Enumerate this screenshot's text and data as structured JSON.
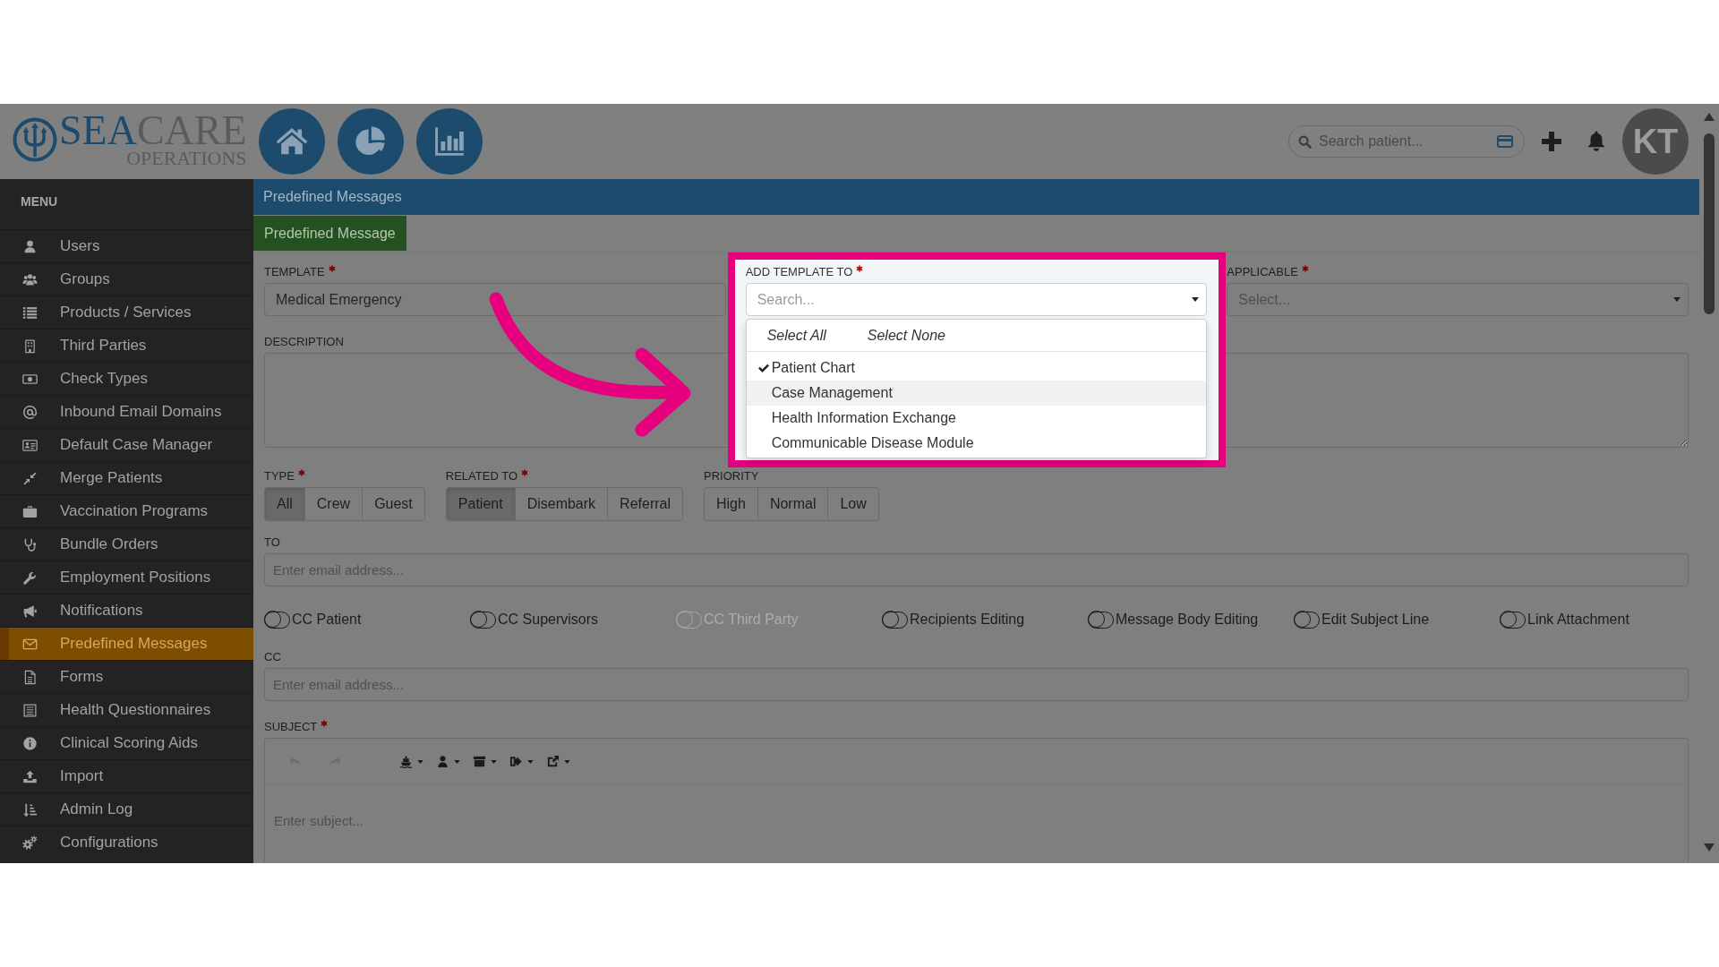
{
  "header": {
    "logo": {
      "wordmark": [
        {
          "text": "SEA",
          "color": "#1c4b6e"
        },
        {
          "text": "CARE",
          "color": "#5b5b5b"
        }
      ],
      "tagline": "OPERATIONS"
    },
    "search": {
      "placeholder": "Search patient..."
    },
    "avatar": {
      "initials": "KT"
    }
  },
  "sidebar": {
    "title": "MENU",
    "items": [
      {
        "label": "Users",
        "selected": false
      },
      {
        "label": "Groups",
        "selected": false
      },
      {
        "label": "Products / Services",
        "selected": false
      },
      {
        "label": "Third Parties",
        "selected": false
      },
      {
        "label": "Check Types",
        "selected": false
      },
      {
        "label": "Inbound Email Domains",
        "selected": false
      },
      {
        "label": "Default Case Manager",
        "selected": false
      },
      {
        "label": "Merge Patients",
        "selected": false
      },
      {
        "label": "Vaccination Programs",
        "selected": false
      },
      {
        "label": "Bundle Orders",
        "selected": false
      },
      {
        "label": "Employment Positions",
        "selected": false
      },
      {
        "label": "Notifications",
        "selected": false
      },
      {
        "label": "Predefined Messages",
        "selected": true
      },
      {
        "label": "Forms",
        "selected": false
      },
      {
        "label": "Health Questionnaires",
        "selected": false
      },
      {
        "label": "Clinical Scoring Aids",
        "selected": false
      },
      {
        "label": "Import",
        "selected": false
      },
      {
        "label": "Admin Log",
        "selected": false
      },
      {
        "label": "Configurations",
        "selected": false
      }
    ]
  },
  "page": {
    "title": "Predefined Messages",
    "tabs": [
      {
        "label": "Predefined Message",
        "selected": true
      }
    ]
  },
  "form": {
    "template": {
      "label": "TEMPLATE",
      "required": true,
      "value": "Medical Emergency"
    },
    "add_template_to": {
      "label": "ADD TEMPLATE TO",
      "required": true,
      "placeholder": "Search...",
      "expanded": true,
      "highlighted": true,
      "actions": [
        "Select All",
        "Select None"
      ],
      "options": [
        {
          "label": "Patient Chart",
          "checked": true,
          "highlighted": false
        },
        {
          "label": "Case Management",
          "checked": false,
          "highlighted": true
        },
        {
          "label": "Health Information Exchange",
          "checked": false,
          "highlighted": false
        },
        {
          "label": "Communicable Disease Module",
          "checked": false,
          "highlighted": false
        }
      ]
    },
    "applicable": {
      "label": "APPLICABLE",
      "required": true,
      "placeholder": "Select..."
    },
    "description": {
      "label": "DESCRIPTION"
    },
    "type": {
      "label": "TYPE",
      "required": true,
      "options": [
        {
          "label": "All",
          "selected": true
        },
        {
          "label": "Crew",
          "selected": false
        },
        {
          "label": "Guest",
          "selected": false
        }
      ]
    },
    "related_to": {
      "label": "RELATED TO",
      "required": true,
      "options": [
        {
          "label": "Patient",
          "selected": true
        },
        {
          "label": "Disembark",
          "selected": false
        },
        {
          "label": "Referral",
          "selected": false
        }
      ]
    },
    "priority": {
      "label": "PRIORITY",
      "options": [
        {
          "label": "High",
          "selected": false
        },
        {
          "label": "Normal",
          "selected": false
        },
        {
          "label": "Low",
          "selected": false
        }
      ]
    },
    "to": {
      "label": "TO",
      "placeholder": "Enter email address..."
    },
    "toggles": [
      {
        "label": "CC Patient",
        "on": false,
        "disabled": false
      },
      {
        "label": "CC Supervisors",
        "on": false,
        "disabled": false
      },
      {
        "label": "CC Third Party",
        "on": false,
        "disabled": true
      },
      {
        "label": "Recipients Editing",
        "on": false,
        "disabled": false
      },
      {
        "label": "Message Body Editing",
        "on": false,
        "disabled": false
      },
      {
        "label": "Edit Subject Line",
        "on": false,
        "disabled": false
      },
      {
        "label": "Link Attachment",
        "on": false,
        "disabled": false
      }
    ],
    "cc": {
      "label": "CC",
      "placeholder": "Enter email address..."
    },
    "subject": {
      "label": "SUBJECT",
      "required": true,
      "placeholder": "Enter subject...",
      "toolbar": [
        {
          "kind": "button",
          "disabled": true
        },
        {
          "kind": "button",
          "disabled": true
        },
        {
          "kind": "menu",
          "disabled": false
        },
        {
          "kind": "menu",
          "disabled": false
        },
        {
          "kind": "menu",
          "disabled": false
        },
        {
          "kind": "menu",
          "disabled": false
        },
        {
          "kind": "menu",
          "disabled": false
        }
      ]
    }
  }
}
